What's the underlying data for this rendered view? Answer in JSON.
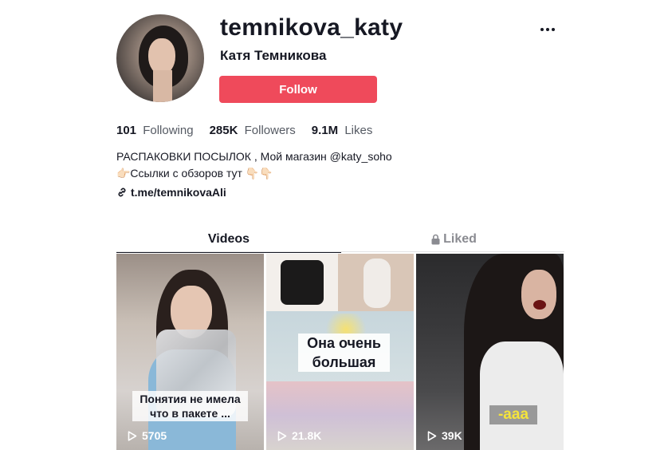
{
  "profile": {
    "username": "temnikova_katy",
    "nickname": "Катя Темникова",
    "follow_label": "Follow",
    "more_icon": "more-dots-icon"
  },
  "stats": {
    "following_count": "101",
    "following_label": "Following",
    "followers_count": "285K",
    "followers_label": "Followers",
    "likes_count": "9.1M",
    "likes_label": "Likes"
  },
  "bio": {
    "line1": "РАСПАКОВКИ ПОСЫЛОК , Мой магазин @katy_soho",
    "line2": "👉🏻Ссылки с обзоров тут 👇🏻👇🏻"
  },
  "link": {
    "text": "t.me/temnikovaAli",
    "icon": "link-icon"
  },
  "tabs": {
    "videos": "Videos",
    "liked": "Liked",
    "liked_icon": "lock-icon"
  },
  "videos": [
    {
      "caption": "Понятия не имела что в пакете ...",
      "views": "5705"
    },
    {
      "caption": "Она очень большая",
      "views": "21.8K"
    },
    {
      "caption": "-ааа",
      "views": "39K"
    }
  ],
  "colors": {
    "follow_button": "#ef4a5b",
    "text_primary": "#161823",
    "text_secondary": "#555a63",
    "tab_inactive": "#8a8b91"
  }
}
